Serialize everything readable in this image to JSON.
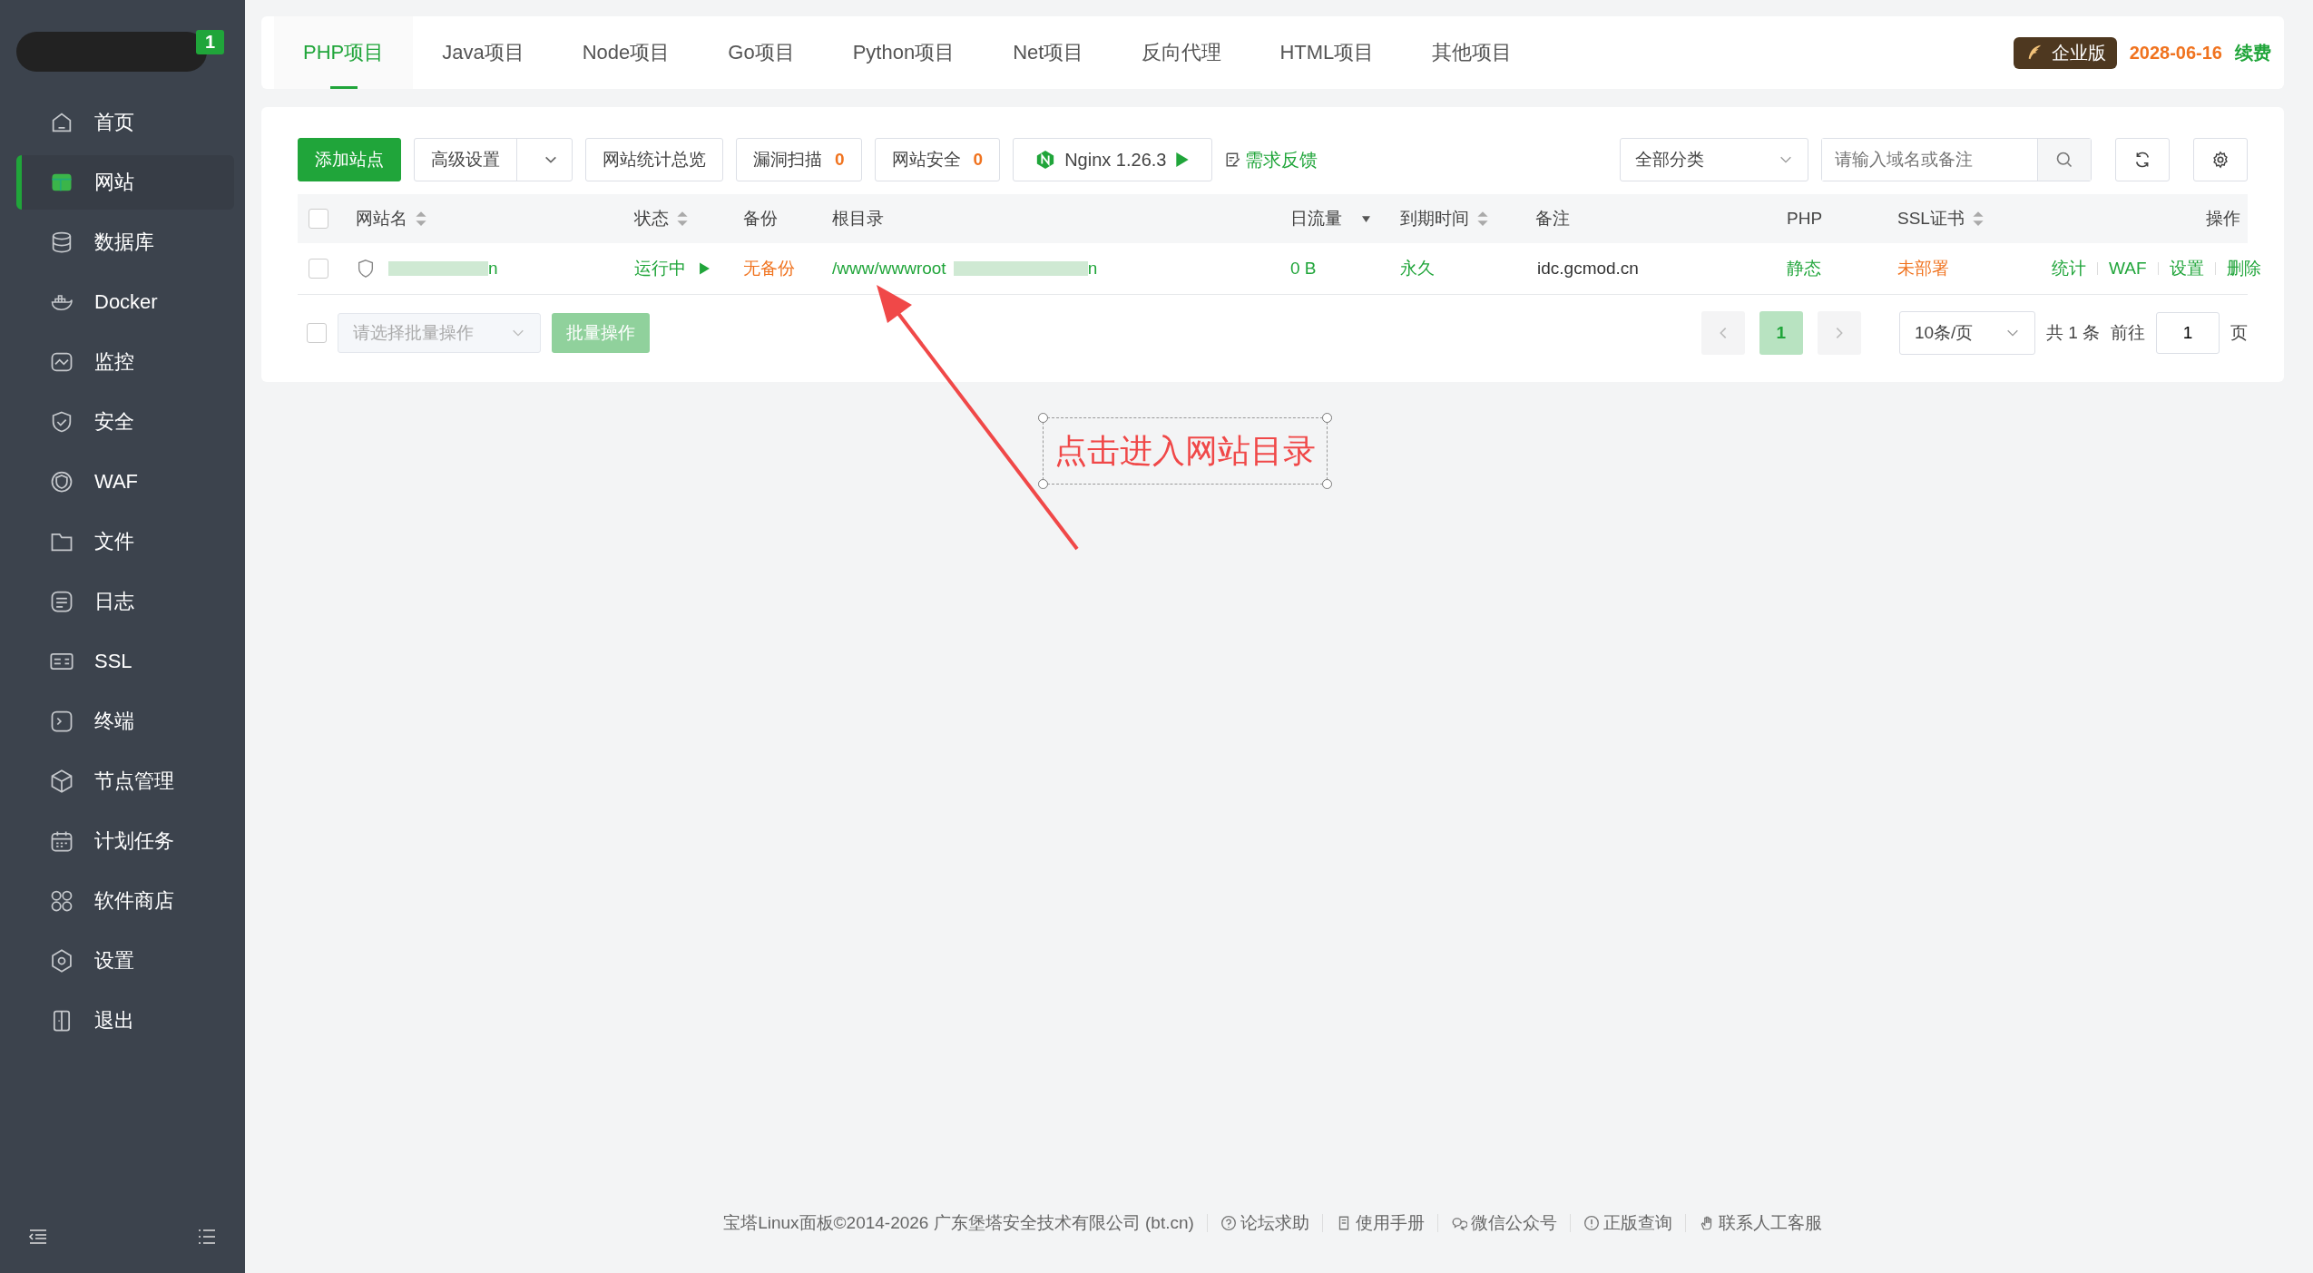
{
  "sidebar": {
    "badge": "1",
    "items": [
      {
        "label": "首页",
        "selected": false
      },
      {
        "label": "网站",
        "selected": true
      },
      {
        "label": "数据库",
        "selected": false
      },
      {
        "label": "Docker",
        "selected": false
      },
      {
        "label": "监控",
        "selected": false
      },
      {
        "label": "安全",
        "selected": false
      },
      {
        "label": "WAF",
        "selected": false
      },
      {
        "label": "文件",
        "selected": false
      },
      {
        "label": "日志",
        "selected": false
      },
      {
        "label": "SSL",
        "selected": false
      },
      {
        "label": "终端",
        "selected": false
      },
      {
        "label": "节点管理",
        "selected": false
      },
      {
        "label": "计划任务",
        "selected": false
      },
      {
        "label": "软件商店",
        "selected": false
      },
      {
        "label": "设置",
        "selected": false
      },
      {
        "label": "退出",
        "selected": false
      }
    ]
  },
  "tabs": [
    {
      "label": "PHP项目",
      "selected": true
    },
    {
      "label": "Java项目",
      "selected": false
    },
    {
      "label": "Node项目",
      "selected": false
    },
    {
      "label": "Go项目",
      "selected": false
    },
    {
      "label": "Python项目",
      "selected": false
    },
    {
      "label": "Net项目",
      "selected": false
    },
    {
      "label": "反向代理",
      "selected": false
    },
    {
      "label": "HTML项目",
      "selected": false
    },
    {
      "label": "其他项目",
      "selected": false
    }
  ],
  "edition": {
    "label": "企业版",
    "expiry": "2028-06-16",
    "renew": "续费"
  },
  "toolbar": {
    "add": "添加站点",
    "advanced": "高级设置",
    "stats": "网站统计总览",
    "vuln_scan": {
      "label": "漏洞扫描",
      "count": "0"
    },
    "site_security": {
      "label": "网站安全",
      "count": "0"
    },
    "nginx": "Nginx 1.26.3",
    "feedback": "需求反馈",
    "category": "全部分类",
    "search": {
      "placeholder": "请输入域名或备注"
    }
  },
  "table": {
    "select_all": {
      "checked": false
    },
    "columns": [
      {
        "label": "网站名",
        "sortable": true
      },
      {
        "label": "状态",
        "sortable": true
      },
      {
        "label": "备份"
      },
      {
        "label": "根目录"
      },
      {
        "label": "日流量",
        "filter": true
      },
      {
        "label": "到期时间",
        "sortable": true
      },
      {
        "label": "备注"
      },
      {
        "label": "PHP"
      },
      {
        "label": "SSL证书",
        "sortable": true
      },
      {
        "label": "操作"
      }
    ],
    "rows": [
      {
        "checked": false,
        "name": "n",
        "status": {
          "text": "运行中",
          "color": "#20a53a"
        },
        "backup": {
          "text": "无备份",
          "color": "#f0731f"
        },
        "root": {
          "prefix": "/www/wwwroot",
          "suffix": "n"
        },
        "traffic": {
          "text": "0 B",
          "color": "#20a53a"
        },
        "expiry": {
          "text": "永久",
          "color": "#20a53a"
        },
        "note": "idc.gcmod.cn",
        "php": {
          "text": "静态",
          "color": "#20a53a"
        },
        "ssl": {
          "text": "未部署",
          "color": "#f0731f"
        },
        "actions": [
          "统计",
          "WAF",
          "设置",
          "删除"
        ]
      }
    ]
  },
  "batch": {
    "checked": false,
    "placeholder": "请选择批量操作",
    "button": "批量操作"
  },
  "pager": {
    "pages": [
      {
        "label": "1",
        "selected": true
      }
    ],
    "page_size": "10条/页",
    "total": "共 1 条",
    "goto": "前往",
    "goto_value": "1",
    "page_unit": "页"
  },
  "annotation": {
    "text": "点击进入网站目录"
  },
  "footer": {
    "copyright": "宝塔Linux面板©2014-2026 广东堡塔安全技术有限公司 (bt.cn)",
    "links": [
      "论坛求助",
      "使用手册",
      "微信公众号",
      "正版查询",
      "联系人工客服"
    ]
  }
}
